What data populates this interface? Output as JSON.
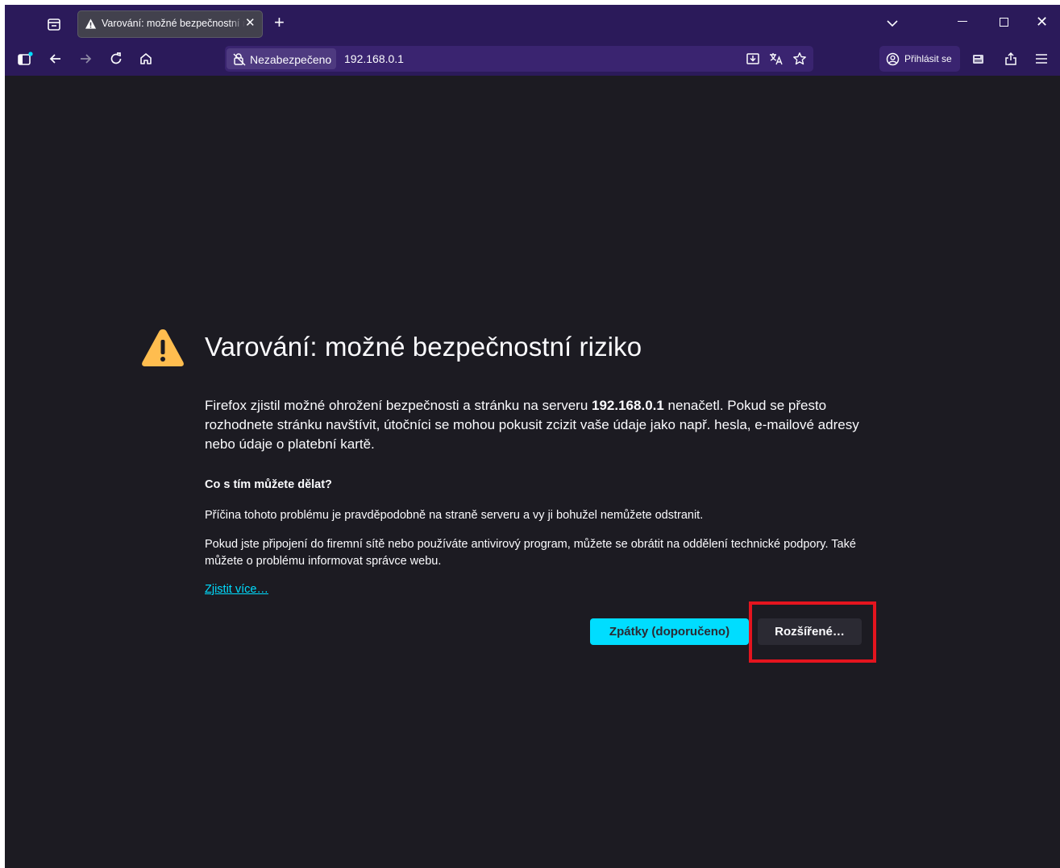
{
  "colors": {
    "titlebar": "#2b1a5a",
    "urlbar": "#3a2470",
    "content_bg": "#1c1b22",
    "text": "#fbfbfe",
    "accent_button": "#00ddff",
    "link": "#00ddff",
    "warning_icon": "#ffbd4f",
    "highlight_box": "#e4141e"
  },
  "tabs": [
    {
      "title": "Varování: možné bezpečnostní riziko",
      "icon": "warning-icon",
      "active": true
    }
  ],
  "toolbar": {
    "identity_label": "Nezabezpečeno",
    "url": "192.168.0.1",
    "signin_label": "Přihlásit se",
    "icons": [
      "sidebar-icon",
      "back-icon",
      "forward-icon",
      "reload-icon",
      "home-icon",
      "save-page-icon",
      "translate-icon",
      "bookmark-star-icon",
      "account-icon",
      "extension-icon",
      "share-icon",
      "menu-icon"
    ]
  },
  "page": {
    "heading": "Varování: možné bezpečnostní riziko",
    "description_before": "Firefox zjistil možné ohrožení bezpečnosti a stránku na serveru ",
    "description_host": "192.168.0.1",
    "description_after": " nenačetl. Pokud se přesto rozhodnete stránku navštívit, útočníci se mohou pokusit zcizit vaše údaje jako např. hesla, e-mailové adresy nebo údaje o platební kartě.",
    "subheading": "Co s tím můžete dělat?",
    "paragraph1": "Příčina tohoto problému je pravděpodobně na straně serveru a vy ji bohužel nemůžete odstranit.",
    "paragraph2": "Pokud jste připojení do firemní sítě nebo používáte antivirový program, můžete se obrátit na oddělení technické podpory. Také můžete o problému informovat správce webu.",
    "learn_more": "Zjistit více…",
    "back_button": "Zpátky (doporučeno)",
    "advanced_button": "Rozšířené…"
  }
}
